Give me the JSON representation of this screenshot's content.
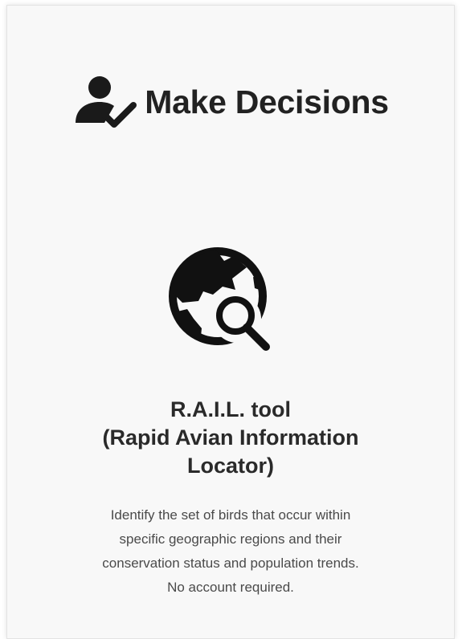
{
  "header": {
    "title": "Make Decisions",
    "icon": "user-check-icon"
  },
  "tool": {
    "icon": "globe-search-icon",
    "title_lines": [
      "R.A.I.L. tool",
      "(Rapid Avian Information",
      "Locator)"
    ],
    "description_lines": [
      "Identify the set of birds that occur within",
      "specific geographic regions and their",
      "conservation status and population trends.",
      "No account required."
    ]
  },
  "colors": {
    "card_background": "#f8f8f8",
    "text_dark": "#222222",
    "text_muted": "#4a4a4a"
  }
}
